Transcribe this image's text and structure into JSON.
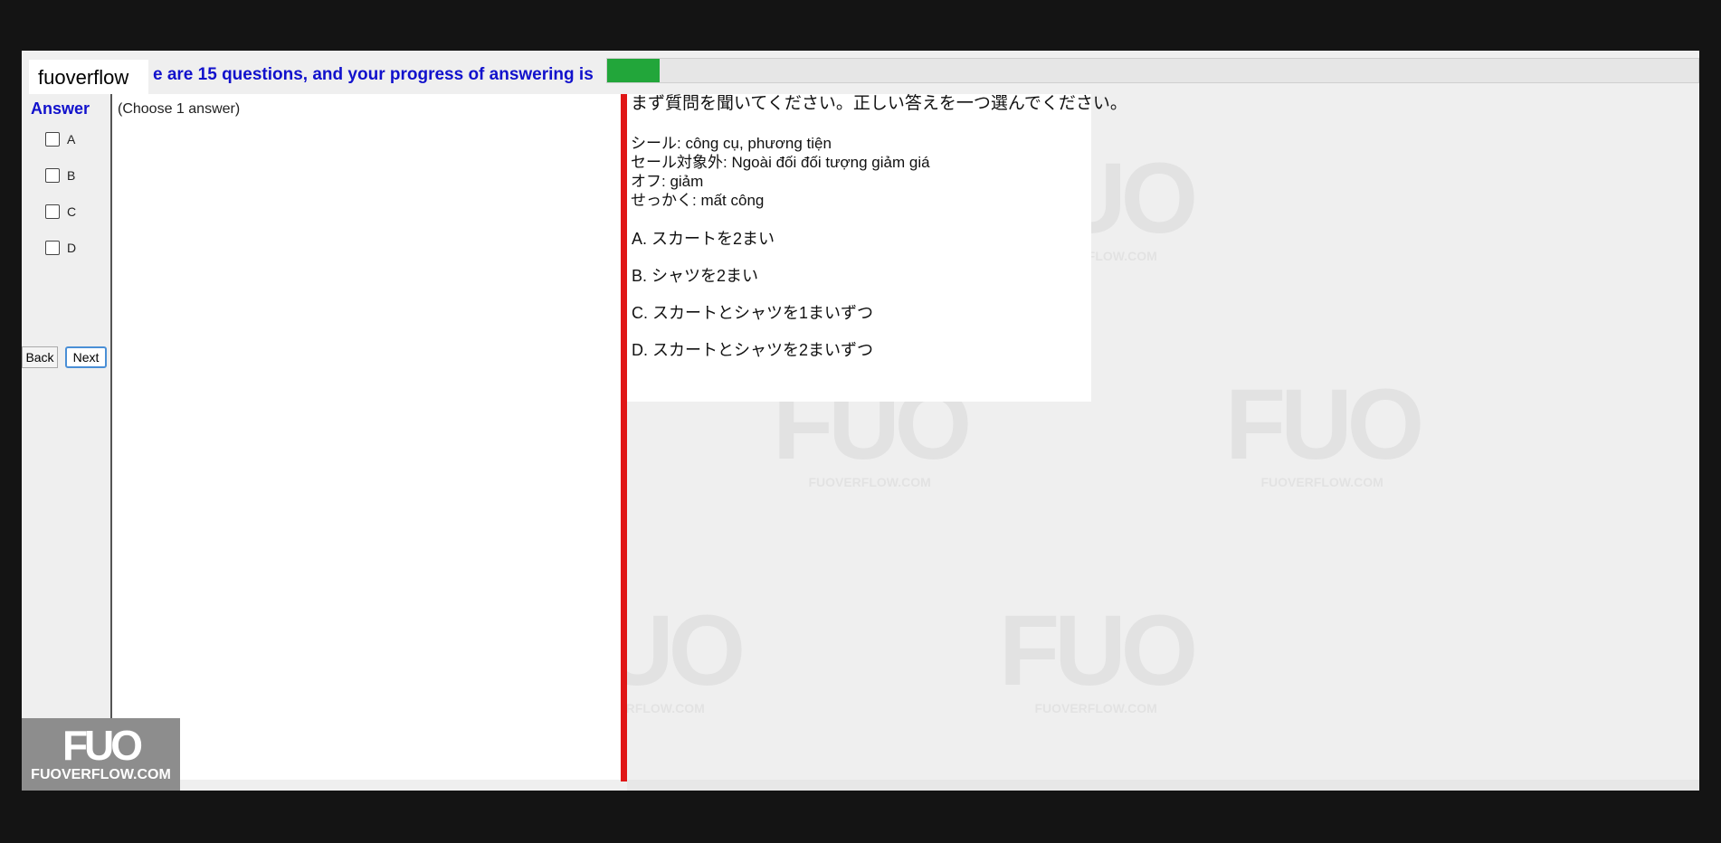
{
  "brand": "fuoverflow",
  "header": {
    "status_text": "e are 15 questions, and your progress of answering is",
    "progress": 0.048
  },
  "sidebar": {
    "answer_title": "Answer",
    "options": [
      "A",
      "B",
      "C",
      "D"
    ],
    "back_label": "Back",
    "next_label": "Next"
  },
  "left_pane": {
    "choose_label": "(Choose 1 answer)"
  },
  "question": {
    "title": "まず質問を聞いてください。正しい答えを一つ選んでください。",
    "vocab": [
      "シール: công cụ, phương tiện",
      "セール対象外: Ngoài đối đối tượng giảm giá",
      "オフ: giảm",
      "せっかく:  mất công"
    ],
    "choices": [
      "A.  スカートを2まい",
      "B.  シャツを2まい",
      "C.  スカートとシャツを1まいずつ",
      "D.  スカートとシャツを2まいずつ"
    ]
  },
  "watermark": {
    "logo": "FUO",
    "site": "FUOVERFLOW.COM"
  },
  "colors": {
    "accent_blue": "#1111cc",
    "progress_green": "#22a63a",
    "divider_red": "#e01616"
  }
}
